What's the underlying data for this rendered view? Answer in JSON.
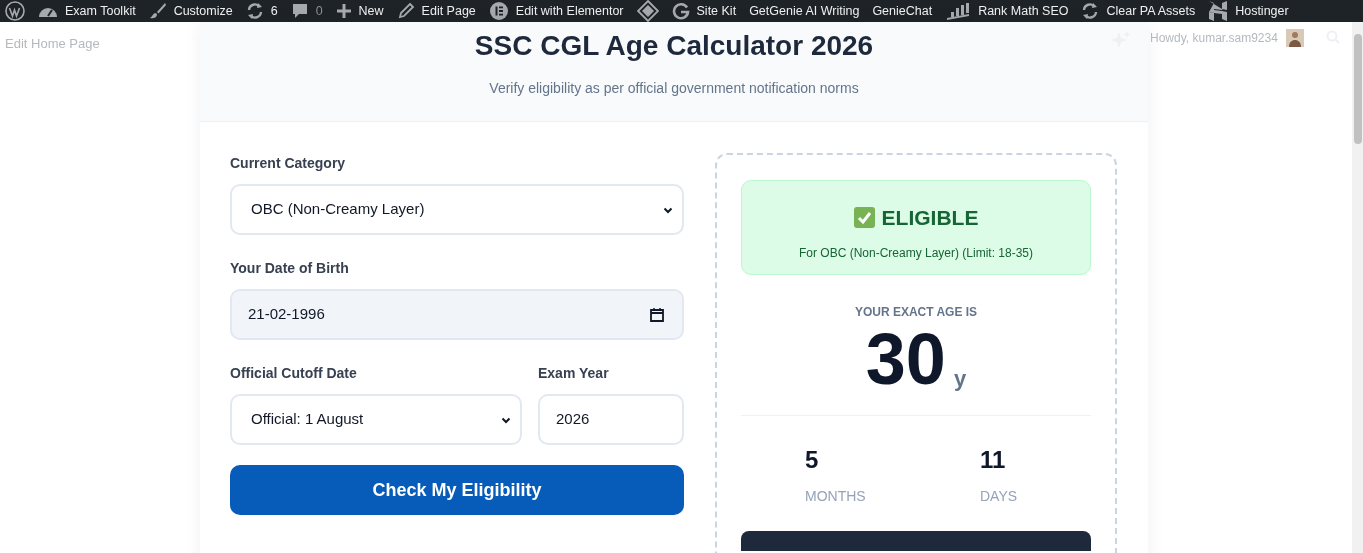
{
  "admin_bar": {
    "items": [
      {
        "kind": "wordpress"
      },
      {
        "kind": "gauge",
        "label": "Exam Toolkit"
      },
      {
        "kind": "brush",
        "label": "Customize"
      },
      {
        "kind": "sync",
        "label": "6"
      },
      {
        "kind": "comment",
        "label": "0"
      },
      {
        "kind": "plus",
        "label": "New"
      },
      {
        "kind": "pencil",
        "label": "Edit Page"
      },
      {
        "kind": "elementor",
        "label": "Edit with Elementor"
      },
      {
        "kind": "diamond"
      },
      {
        "kind": "google",
        "label": "Site Kit"
      },
      {
        "kind": "text",
        "label": "GetGenie AI Writing"
      },
      {
        "kind": "text",
        "label": "GenieChat"
      },
      {
        "kind": "chart",
        "label": "Rank Math SEO"
      },
      {
        "kind": "sync",
        "label": "Clear PA Assets"
      },
      {
        "kind": "hostinger",
        "label": "Hostinger"
      }
    ]
  },
  "edit_link": "Edit Home Page",
  "account": {
    "greeting": "Howdy, kumar.sam9234"
  },
  "calculator": {
    "title": "SSC CGL Age Calculator 2026",
    "subtitle": "Verify eligibility as per official government notification norms",
    "category": {
      "label": "Current Category",
      "value": "OBC (Non-Creamy Layer)"
    },
    "dob": {
      "label": "Your Date of Birth",
      "value": "21-02-1996"
    },
    "cutoff": {
      "label": "Official Cutoff Date",
      "value": "Official: 1 August"
    },
    "exam_year": {
      "label": "Exam Year",
      "value": "2026"
    },
    "submit": "Check My Eligibility",
    "result": {
      "eligible": true,
      "status": "ELIGIBLE",
      "detail": "For OBC (Non-Creamy Layer) (Limit: 18-35)",
      "age_label": "YOUR EXACT AGE IS",
      "years": "30",
      "years_unit": "y",
      "parts": [
        {
          "value": "5",
          "label": "MONTHS"
        },
        {
          "value": "11",
          "label": "DAYS"
        }
      ]
    }
  }
}
